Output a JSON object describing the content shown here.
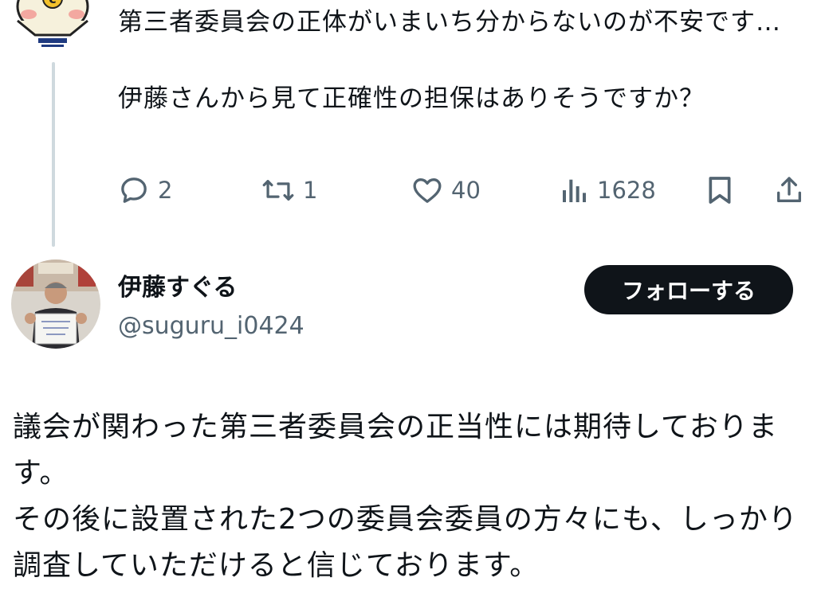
{
  "parent_tweet": {
    "text": "第三者委員会の正体がいまいち分からないのが不安です…\n\n伊藤さんから見て正確性の担保はありそうですか？",
    "actions": {
      "reply_count": "2",
      "retweet_count": "1",
      "like_count": "40",
      "view_count": "1628"
    },
    "avatar_icon": "cartoon-mascot-avatar"
  },
  "reply": {
    "author_name": "伊藤すぐる",
    "author_handle": "@suguru_i0424",
    "follow_label": "フォローする",
    "text": "議会が関わった第三者委員会の正当性には期待しております。\nその後に設置された2つの委員会委員の方々にも、しっかり調査していただけると信じております。",
    "avatar_icon": "photo-avatar"
  },
  "colors": {
    "text": "#0f1419",
    "muted": "#536471",
    "thread_line": "#cfd9de",
    "follow_button_bg": "#0f1419"
  }
}
